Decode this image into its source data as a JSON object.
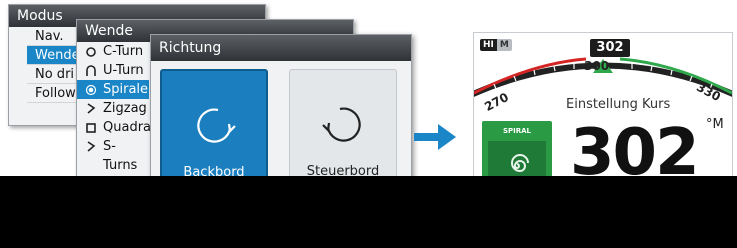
{
  "modus": {
    "title": "Modus",
    "items": [
      {
        "label": "Nav."
      },
      {
        "label": "Wende"
      },
      {
        "label": "No dri"
      },
      {
        "label": "Follow"
      }
    ],
    "selected_index": 1
  },
  "wende": {
    "title": "Wende",
    "items": [
      {
        "label": "C-Turn",
        "icon": "circle-icon"
      },
      {
        "label": "U-Turn",
        "icon": "u-turn-icon"
      },
      {
        "label": "Spirale",
        "icon": "spiral-radio-icon"
      },
      {
        "label": "Zigzag",
        "icon": "zigzag-icon"
      },
      {
        "label": "Quadra",
        "icon": "square-icon"
      },
      {
        "label": "S-Turns",
        "icon": "s-turn-icon"
      }
    ],
    "selected_index": 2
  },
  "richtung": {
    "title": "Richtung",
    "buttons": [
      {
        "label": "Backbord",
        "icon": "rotate-counterclockwise-icon",
        "selected": true
      },
      {
        "label": "Steuerbord",
        "icon": "rotate-clockwise-icon",
        "selected": false
      }
    ]
  },
  "display": {
    "hi_label": "HI",
    "m_label": "M",
    "heading": "302",
    "set_heading_tick": "300",
    "left_tick": "270",
    "right_tick": "330",
    "setting_label": "Einstellung Kurs",
    "set_value": "302",
    "unit_label": "°M",
    "mode_tile_label": "SPIRAL",
    "colors": {
      "port_arc": "#d42424",
      "starboard_arc": "#2ea84a",
      "marker": "#2ea84a",
      "mode_tile": "#2a9a45"
    }
  },
  "colors": {
    "selected_blue": "#1a86c8",
    "title_bar": "#3a3d41"
  }
}
